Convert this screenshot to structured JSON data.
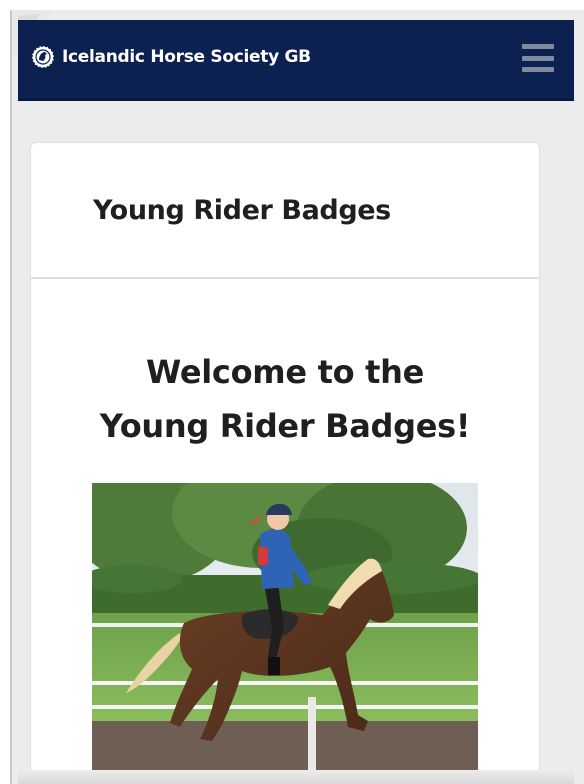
{
  "navbar": {
    "brand_text": "Icelandic Horse Society GB",
    "logo_icon": "society-logo-icon",
    "menu_icon": "hamburger-menu-icon",
    "background_color": "#0d2150"
  },
  "card": {
    "header_title": "Young Rider Badges",
    "welcome_line1": "Welcome to the",
    "welcome_line2": "Young Rider Badges!",
    "image_subject": "rider-on-horse-photo"
  }
}
